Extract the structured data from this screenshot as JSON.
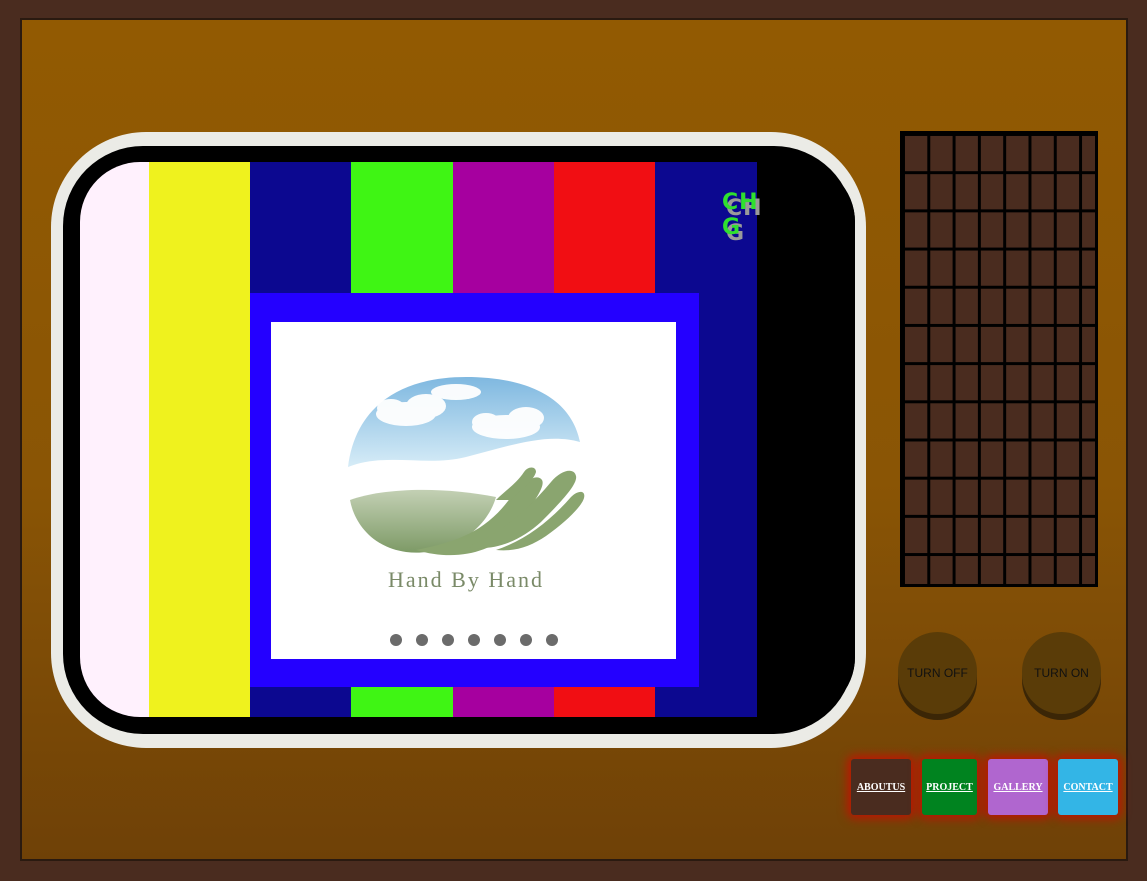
{
  "channel": {
    "label": "CH G"
  },
  "test_pattern": {
    "top_bars": [
      "#fff1fd",
      "#eff21e",
      "#0c0890",
      "#3ff514",
      "#a6009f",
      "#f10e13",
      "#0c0890",
      "#000000"
    ],
    "bottom_bars": [
      "#fff1fd",
      "#eff21e",
      "#0c0890",
      "#3ff514",
      "#a6009f",
      "#f10e13",
      "#0c0890",
      "#000000"
    ]
  },
  "slider": {
    "frame_color": "#2400ff",
    "slide": {
      "logo_text": "Hand By Hand"
    },
    "dot_count": 7
  },
  "speaker": {
    "icon": "speaker-grille"
  },
  "controls": {
    "turn_off": "TURN OFF",
    "turn_on": "TURN ON"
  },
  "nav": {
    "about": {
      "label": "ABOUTUS",
      "color": "#4a2c1f"
    },
    "project": {
      "label": "PROJECT",
      "color": "#00831f"
    },
    "gallery": {
      "label": "GALLERY",
      "color": "#b066cf"
    },
    "contact": {
      "label": "CONTACT",
      "color": "#33b5e6"
    }
  },
  "colors": {
    "cabinet": "#925a02",
    "bezel": "#ebebe6",
    "knob": "#5a3c08"
  }
}
